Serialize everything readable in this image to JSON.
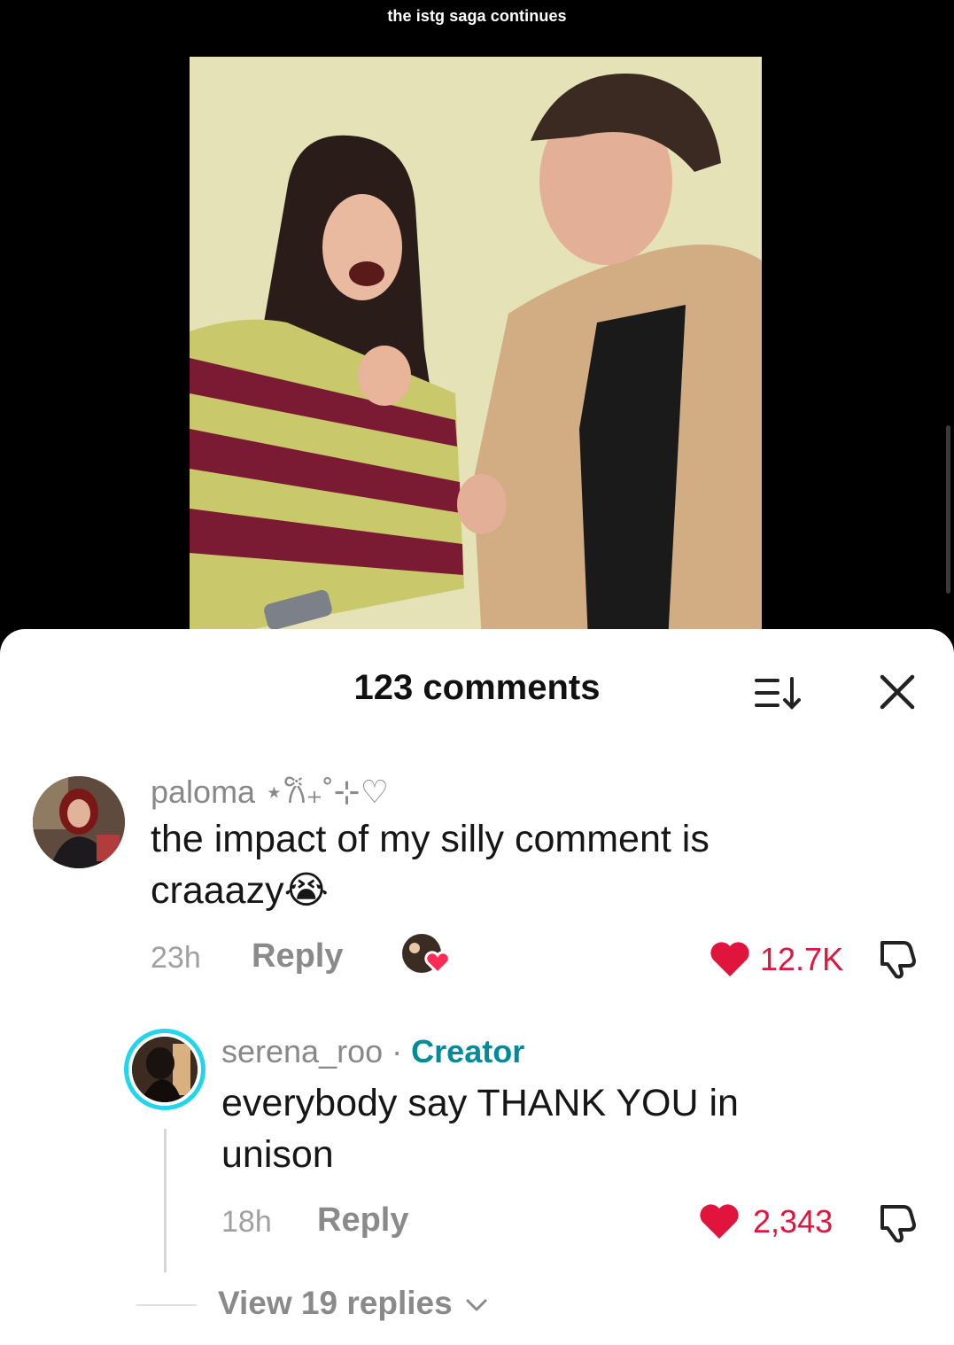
{
  "video": {
    "caption": "the istg saga continues"
  },
  "comments_sheet": {
    "title": "123 comments",
    "sort_icon": "sort-down-icon",
    "close_icon": "close-icon"
  },
  "comment": {
    "username": "paloma ⋆𐙚₊˚⊹♡",
    "text_line1": "the impact of my silly comment is",
    "text_line2": "craaazy😭",
    "time": "23h",
    "reply_label": "Reply",
    "likes": "12.7K",
    "creator_liked_icon": "creator-liked-heart-icon"
  },
  "reply": {
    "username": "serena_roo",
    "separator": "·",
    "badge": "Creator",
    "text_line1": "everybody say THANK YOU in",
    "text_line2": "unison",
    "time": "18h",
    "reply_label": "Reply",
    "likes": "2,343"
  },
  "view_replies": {
    "label": "View 19 replies",
    "icon": "chevron-down-icon"
  },
  "colors": {
    "like_red": "#e0143c",
    "creator_teal": "#008b9a",
    "ring_cyan": "#20d5ec"
  }
}
